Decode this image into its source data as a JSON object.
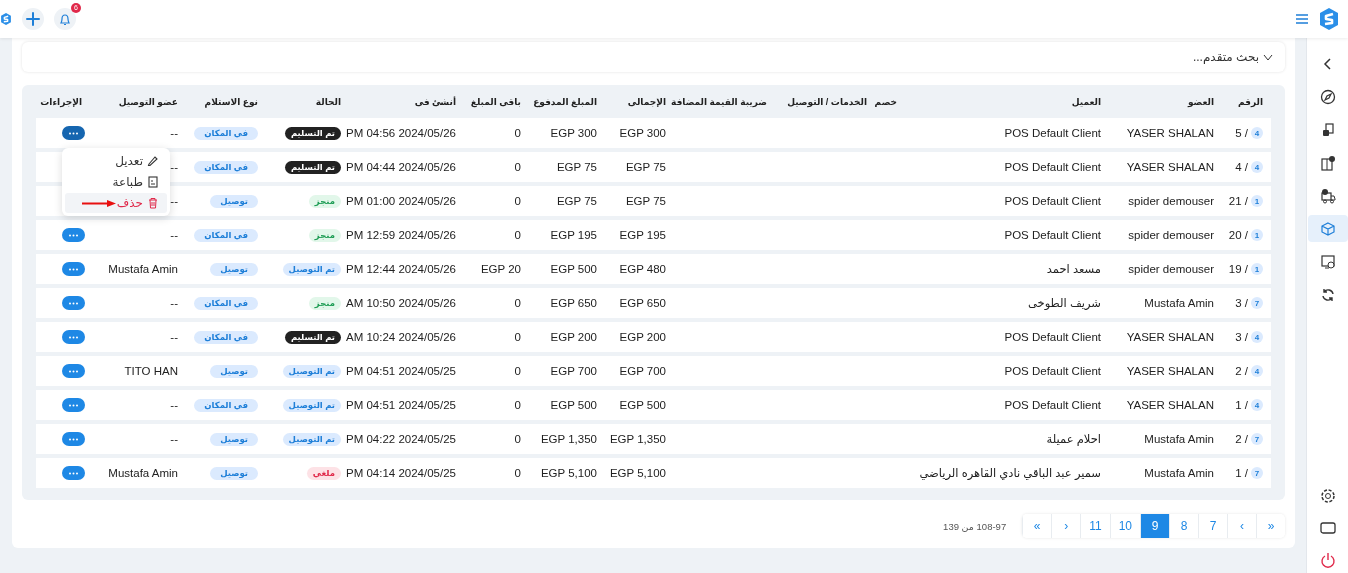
{
  "top_bar": {
    "notifications_count": "6"
  },
  "sidebar": {
    "items": [
      {
        "selected": false
      },
      {
        "selected": false
      },
      {
        "selected": false
      },
      {
        "selected": false
      },
      {
        "selected": false
      },
      {
        "selected": true
      },
      {
        "selected": false
      },
      {
        "selected": false
      }
    ],
    "bottom_items": [
      {
        "selected": false
      },
      {
        "selected": false
      },
      {
        "selected": false
      }
    ]
  },
  "search": {
    "label": "بحث متقدم...",
    "expanded": false
  },
  "table": {
    "columns": [
      "الرقم",
      "العضو",
      "العميل",
      "خصم",
      "الخدمات / التوصيل",
      "ضريبة القيمة المضافة",
      "الإجمالى",
      "المبلغ المدفوع",
      "باقى المبلغ",
      "أنشئ فى",
      "الحالة",
      "نوع الاستلام",
      "عضو التوصيل",
      "الإجراءات"
    ],
    "rows": [
      {
        "number": "5 /",
        "count": "4",
        "member": "YASER SHALAN",
        "client": "POS Default Client",
        "total": "EGP 300",
        "paid": "EGP 300",
        "remaining": "0",
        "created": "PM 04:56 2024/05/26",
        "status": {
          "text": "تم التسليم",
          "kind": "handed"
        },
        "receipt": "في المكان",
        "courier": "--",
        "selected": true
      },
      {
        "number": "4 /",
        "count": "4",
        "member": "YASER SHALAN",
        "client": "POS Default Client",
        "total": "EGP 75",
        "paid": "EGP 75",
        "remaining": "0",
        "created": "PM 04:44 2024/05/26",
        "status": {
          "text": "تم التسليم",
          "kind": "handed"
        },
        "receipt": "في المكان",
        "courier": "--",
        "selected": false
      },
      {
        "number": "21 /",
        "count": "1",
        "member": "spider demouser",
        "client": "POS Default Client",
        "total": "EGP 75",
        "paid": "EGP 75",
        "remaining": "0",
        "created": "PM 01:00 2024/05/26",
        "status": {
          "text": "منجز",
          "kind": "done"
        },
        "receipt": "توصيل",
        "courier": "--",
        "selected": false
      },
      {
        "number": "20 /",
        "count": "1",
        "member": "spider demouser",
        "client": "POS Default Client",
        "total": "EGP 195",
        "paid": "EGP 195",
        "remaining": "0",
        "created": "PM 12:59 2024/05/26",
        "status": {
          "text": "منجز",
          "kind": "done"
        },
        "receipt": "في المكان",
        "courier": "--",
        "selected": false
      },
      {
        "number": "19 /",
        "count": "1",
        "member": "spider demouser",
        "client": "مسعد احمد",
        "total": "EGP 480",
        "paid": "EGP 500",
        "remaining": "EGP 20",
        "created": "PM 12:44 2024/05/26",
        "status": {
          "text": "تم التوصيل",
          "kind": "delivered"
        },
        "receipt": "توصيل",
        "courier": "Mustafa Amin",
        "selected": false
      },
      {
        "number": "3 /",
        "count": "7",
        "member": "Mustafa Amin",
        "client": "شريف الطوخى",
        "total": "EGP 650",
        "paid": "EGP 650",
        "remaining": "0",
        "created": "AM 10:50 2024/05/26",
        "status": {
          "text": "منجز",
          "kind": "done"
        },
        "receipt": "في المكان",
        "courier": "--",
        "selected": false
      },
      {
        "number": "3 /",
        "count": "4",
        "member": "YASER SHALAN",
        "client": "POS Default Client",
        "total": "EGP 200",
        "paid": "EGP 200",
        "remaining": "0",
        "created": "AM 10:24 2024/05/26",
        "status": {
          "text": "تم التسليم",
          "kind": "handed"
        },
        "receipt": "في المكان",
        "courier": "--",
        "selected": false
      },
      {
        "number": "2 /",
        "count": "4",
        "member": "YASER SHALAN",
        "client": "POS Default Client",
        "total": "EGP 700",
        "paid": "EGP 700",
        "remaining": "0",
        "created": "PM 04:51 2024/05/25",
        "status": {
          "text": "تم التوصيل",
          "kind": "delivered"
        },
        "receipt": "توصيل",
        "courier": "TITO HAN",
        "selected": false
      },
      {
        "number": "1 /",
        "count": "4",
        "member": "YASER SHALAN",
        "client": "POS Default Client",
        "total": "EGP 500",
        "paid": "EGP 500",
        "remaining": "0",
        "created": "PM 04:51 2024/05/25",
        "status": {
          "text": "تم التوصيل",
          "kind": "delivered"
        },
        "receipt": "في المكان",
        "courier": "--",
        "selected": false
      },
      {
        "number": "2 /",
        "count": "7",
        "member": "Mustafa Amin",
        "client": "احلام عميلة",
        "total": "EGP 1,350",
        "paid": "EGP 1,350",
        "remaining": "0",
        "created": "PM 04:22 2024/05/25",
        "status": {
          "text": "تم التوصيل",
          "kind": "delivered"
        },
        "receipt": "توصيل",
        "courier": "--",
        "selected": false
      },
      {
        "number": "1 /",
        "count": "7",
        "member": "Mustafa Amin",
        "client": "سمير عبد الباقي نادي القاهره الرياضي",
        "total": "EGP 5,100",
        "paid": "EGP 5,100",
        "remaining": "0",
        "created": "PM 04:14 2024/05/25",
        "status": {
          "text": "ملغي",
          "kind": "cancelled"
        },
        "receipt": "توصيل",
        "courier": "Mustafa Amin",
        "selected": false
      }
    ]
  },
  "row_menu": {
    "items": [
      {
        "label": "تعديل",
        "kind": "edit",
        "hovered": false,
        "marked": false
      },
      {
        "label": "طباعة",
        "kind": "print",
        "hovered": false,
        "marked": false
      },
      {
        "label": "حذف",
        "kind": "delete",
        "hovered": true,
        "marked": true
      }
    ]
  },
  "pagination": {
    "range": "108-97 من 139",
    "buttons": [
      {
        "label": "»",
        "selected": false
      },
      {
        "label": "‹",
        "selected": false
      },
      {
        "label": "7",
        "selected": false
      },
      {
        "label": "8",
        "selected": false
      },
      {
        "label": "9",
        "selected": true
      },
      {
        "label": "10",
        "selected": false
      },
      {
        "label": "11",
        "selected": false
      },
      {
        "label": "›",
        "selected": false
      },
      {
        "label": "«",
        "selected": false
      }
    ]
  }
}
